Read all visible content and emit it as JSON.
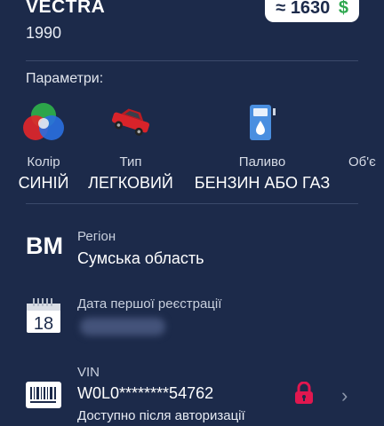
{
  "header": {
    "model": "VECTRA",
    "year": "1990",
    "price_prefix": "≈",
    "price": "1630",
    "currency": "$"
  },
  "params": {
    "title": "Параметри:",
    "items": [
      {
        "label": "Колір",
        "value": "СИНІЙ",
        "icon": "color-wheel-icon"
      },
      {
        "label": "Тип",
        "value": "ЛЕГКОВИЙ",
        "icon": "red-car-icon"
      },
      {
        "label": "Паливо",
        "value": "БЕНЗИН АБО ГАЗ",
        "icon": "fuel-pump-icon"
      },
      {
        "label": "Об'є",
        "value": "",
        "icon": ""
      }
    ]
  },
  "region": {
    "code": "ВМ",
    "label": "Регіон",
    "value": "Сумська область"
  },
  "registration": {
    "label": "Дата першої реєстрації",
    "calendar_day": "18",
    "value_hidden": true
  },
  "vin": {
    "label": "VIN",
    "value": "W0L0********54762",
    "note": "Доступно після авторизації",
    "icon": "barcode-icon"
  },
  "colors": {
    "background": "#1c2a4a",
    "accent_red": "#e0174f",
    "price_green": "#2fa84f"
  }
}
